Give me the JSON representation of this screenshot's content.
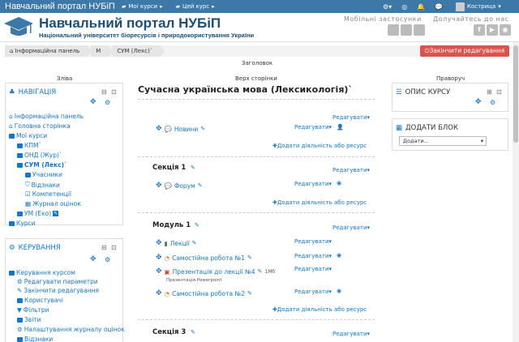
{
  "topbar": {
    "brand": "Навчальний портал НУБіП",
    "menu1": "Мої курси",
    "menu2": "Цей курс",
    "user": "Кострица"
  },
  "header": {
    "title": "Навчальний портал НУБіП",
    "subtitle": "Національний університет біоресурсів і природокористування України",
    "mobile": "Мобільні застосунки",
    "join": "Долучайтесь до нас"
  },
  "breadcrumb": [
    "Інформаційна панель",
    "М",
    "СУМ (Лекс)`"
  ],
  "end_edit": "Закінчити редагування",
  "regions": {
    "top": "Заголовок",
    "left": "Зліва",
    "center": "Верх сторінки",
    "right": "Праворуч"
  },
  "nav": {
    "title": "НАВІГАЦІЯ",
    "items": [
      "Інформаційна панель",
      "Головна сторінка",
      "Мої курси",
      "КПМ`",
      "ОНД (Жур)`",
      "СУМ (Лекс)`",
      "Учасники",
      "Відзнаки",
      "Компетенції",
      "Журнал оцінок",
      "УМ (Еко)",
      "Курси"
    ]
  },
  "admin": {
    "title": "КЕРУВАННЯ",
    "items": [
      "Керування курсом",
      "Редагувати параметри",
      "Закінчити редагування",
      "Користувачі",
      "Фільтри",
      "Звіти",
      "Налаштування журналу оцінок",
      "Відзнаки"
    ]
  },
  "course": {
    "title": "Сучасна українська мова (Лексикологія)`",
    "edit": "Редагувати",
    "add": "Додати діяльність або ресурс",
    "s0": {
      "item": "Новини"
    },
    "s1": {
      "title": "Секція 1",
      "item": "Форум"
    },
    "m1": {
      "title": "Модуль 1",
      "items": [
        "Лекції",
        "Самостійна робота №1",
        "Презентація до лекції №4",
        "Самостійна робота №2"
      ],
      "size": "1Мб",
      "ptype": "Презентація Powerpoint"
    },
    "s3": {
      "title": "Секція 3"
    }
  },
  "desc": {
    "title": "ОПИС КУРСУ"
  },
  "addblock": {
    "title": "ДОДАТИ БЛОК",
    "select": "Додати..."
  }
}
